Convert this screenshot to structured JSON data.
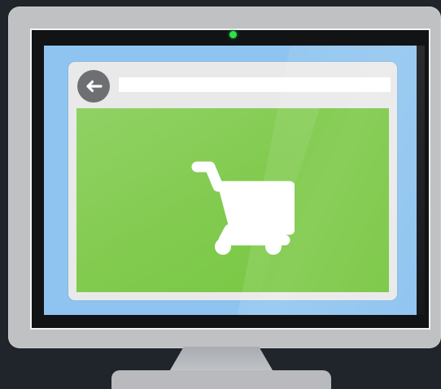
{
  "illustration": {
    "subject": "monitor-shopping-cart",
    "colors": {
      "background": "#1f252b",
      "monitor_body": "#bfc1c3",
      "screen_blue": "#8ec4ef",
      "browser_gray": "#e9e9e9",
      "content_green": "#78c742",
      "camera_green": "#2fe04a",
      "icon_white": "#ffffff",
      "back_button_gray": "#6d6f72"
    },
    "browser": {
      "back_button_icon": "arrow-left-icon",
      "address_bar_value": "",
      "address_bar_placeholder": ""
    },
    "content": {
      "icon": "shopping-cart-icon"
    }
  }
}
